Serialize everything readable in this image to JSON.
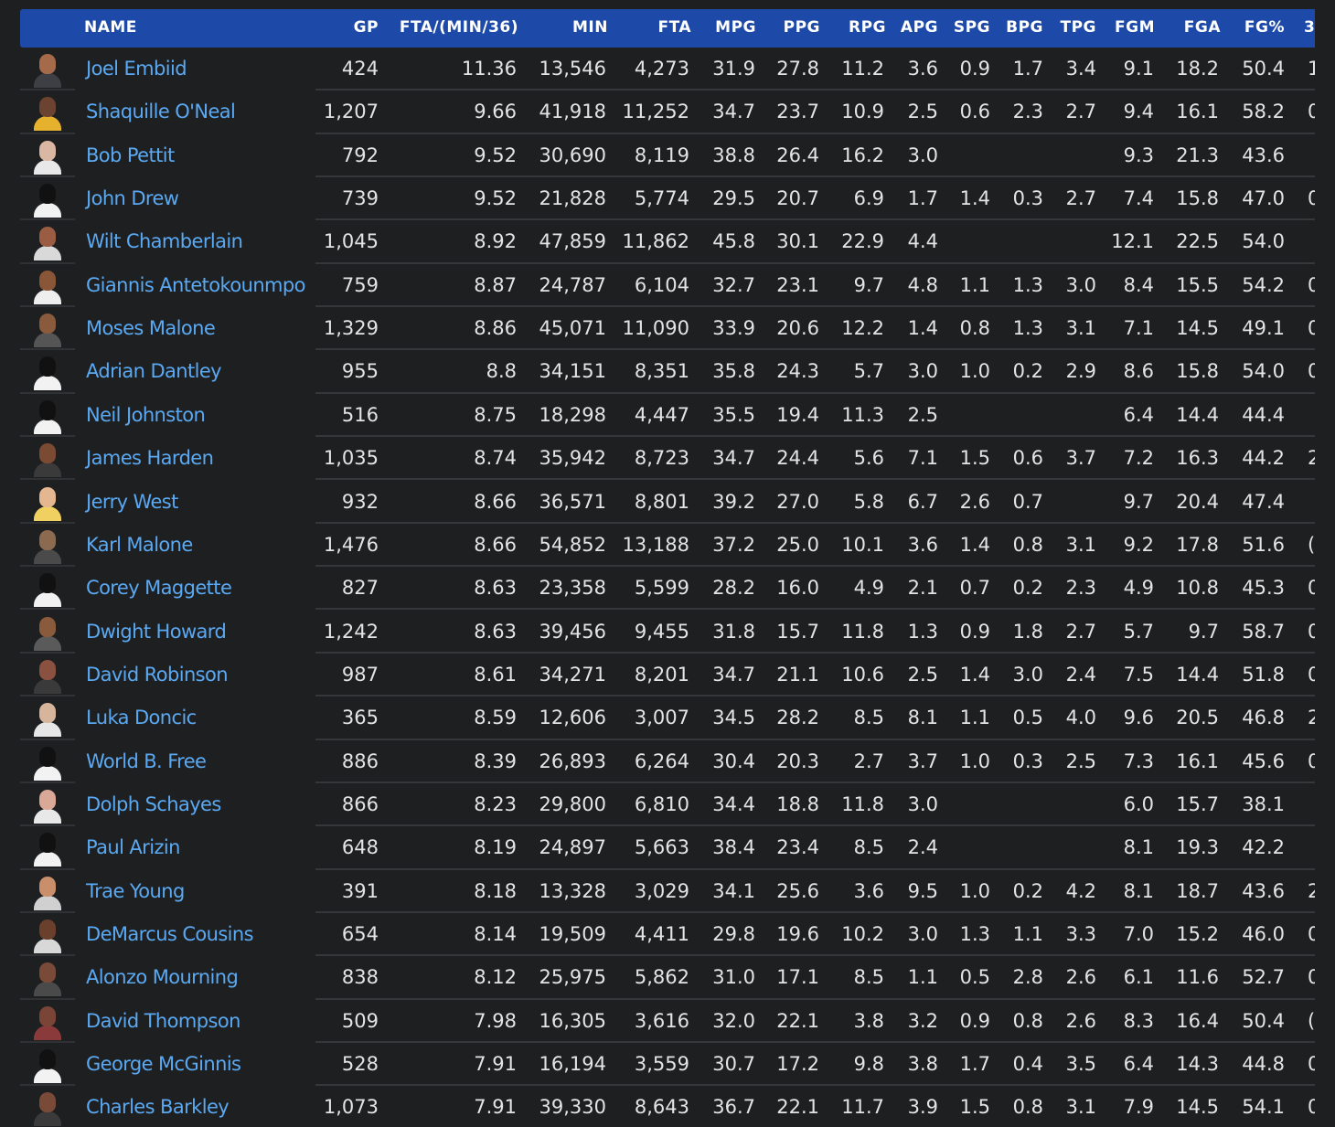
{
  "columns": [
    "NAME",
    "GP",
    "FTA/(MIN/36)",
    "MIN",
    "FTA",
    "MPG",
    "PPG",
    "RPG",
    "APG",
    "SPG",
    "BPG",
    "TPG",
    "FGM",
    "FGA",
    "FG%",
    "3"
  ],
  "colors": {
    "header_bg": "#1d4aa8",
    "name_link": "#5aa9f2",
    "page_bg": "#1e1f21"
  },
  "rows": [
    {
      "name": "Joel Embiid",
      "gp": "424",
      "fta_min36": "11.36",
      "min": "13,546",
      "fta": "4,273",
      "mpg": "31.9",
      "ppg": "27.8",
      "rpg": "11.2",
      "apg": "3.6",
      "spg": "0.9",
      "bpg": "1.7",
      "tpg": "3.4",
      "fgm": "9.1",
      "fga": "18.2",
      "fg_pct": "50.4",
      "three": "1",
      "skin": "#a46a4a",
      "jersey": "#3d3f44"
    },
    {
      "name": "Shaquille O'Neal",
      "gp": "1,207",
      "fta_min36": "9.66",
      "min": "41,918",
      "fta": "11,252",
      "mpg": "34.7",
      "ppg": "23.7",
      "rpg": "10.9",
      "apg": "2.5",
      "spg": "0.6",
      "bpg": "2.3",
      "tpg": "2.7",
      "fgm": "9.4",
      "fga": "16.1",
      "fg_pct": "58.2",
      "three": "0",
      "skin": "#6b4330",
      "jersey": "#e6b22e"
    },
    {
      "name": "Bob Pettit",
      "gp": "792",
      "fta_min36": "9.52",
      "min": "30,690",
      "fta": "8,119",
      "mpg": "38.8",
      "ppg": "26.4",
      "rpg": "16.2",
      "apg": "3.0",
      "spg": "",
      "bpg": "",
      "tpg": "",
      "fgm": "9.3",
      "fga": "21.3",
      "fg_pct": "43.6",
      "three": "",
      "skin": "#d9b7a2",
      "jersey": "#e8e8e8"
    },
    {
      "name": "John Drew",
      "gp": "739",
      "fta_min36": "9.52",
      "min": "21,828",
      "fta": "5,774",
      "mpg": "29.5",
      "ppg": "20.7",
      "rpg": "6.9",
      "apg": "1.7",
      "spg": "1.4",
      "bpg": "0.3",
      "tpg": "2.7",
      "fgm": "7.4",
      "fga": "15.8",
      "fg_pct": "47.0",
      "three": "0",
      "skin": "#111111",
      "jersey": "#f2f2f2"
    },
    {
      "name": "Wilt Chamberlain",
      "gp": "1,045",
      "fta_min36": "8.92",
      "min": "47,859",
      "fta": "11,862",
      "mpg": "45.8",
      "ppg": "30.1",
      "rpg": "22.9",
      "apg": "4.4",
      "spg": "",
      "bpg": "",
      "tpg": "",
      "fgm": "12.1",
      "fga": "22.5",
      "fg_pct": "54.0",
      "three": "",
      "skin": "#9a5d43",
      "jersey": "#d9d9d9"
    },
    {
      "name": "Giannis Antetokounmpo",
      "gp": "759",
      "fta_min36": "8.87",
      "min": "24,787",
      "fta": "6,104",
      "mpg": "32.7",
      "ppg": "23.1",
      "rpg": "9.7",
      "apg": "4.8",
      "spg": "1.1",
      "bpg": "1.3",
      "tpg": "3.0",
      "fgm": "8.4",
      "fga": "15.5",
      "fg_pct": "54.2",
      "three": "0",
      "skin": "#8a5638",
      "jersey": "#eeeeee"
    },
    {
      "name": "Moses Malone",
      "gp": "1,329",
      "fta_min36": "8.86",
      "min": "45,071",
      "fta": "11,090",
      "mpg": "33.9",
      "ppg": "20.6",
      "rpg": "12.2",
      "apg": "1.4",
      "spg": "0.8",
      "bpg": "1.3",
      "tpg": "3.1",
      "fgm": "7.1",
      "fga": "14.5",
      "fg_pct": "49.1",
      "three": "0",
      "skin": "#8a5a3c",
      "jersey": "#555555"
    },
    {
      "name": "Adrian Dantley",
      "gp": "955",
      "fta_min36": "8.8",
      "min": "34,151",
      "fta": "8,351",
      "mpg": "35.8",
      "ppg": "24.3",
      "rpg": "5.7",
      "apg": "3.0",
      "spg": "1.0",
      "bpg": "0.2",
      "tpg": "2.9",
      "fgm": "8.6",
      "fga": "15.8",
      "fg_pct": "54.0",
      "three": "0",
      "skin": "#111111",
      "jersey": "#f2f2f2"
    },
    {
      "name": "Neil Johnston",
      "gp": "516",
      "fta_min36": "8.75",
      "min": "18,298",
      "fta": "4,447",
      "mpg": "35.5",
      "ppg": "19.4",
      "rpg": "11.3",
      "apg": "2.5",
      "spg": "",
      "bpg": "",
      "tpg": "",
      "fgm": "6.4",
      "fga": "14.4",
      "fg_pct": "44.4",
      "three": "",
      "skin": "#111111",
      "jersey": "#f2f2f2"
    },
    {
      "name": "James Harden",
      "gp": "1,035",
      "fta_min36": "8.74",
      "min": "35,942",
      "fta": "8,723",
      "mpg": "34.7",
      "ppg": "24.4",
      "rpg": "5.6",
      "apg": "7.1",
      "spg": "1.5",
      "bpg": "0.6",
      "tpg": "3.7",
      "fgm": "7.2",
      "fga": "16.3",
      "fg_pct": "44.2",
      "three": "2",
      "skin": "#7a4a33",
      "jersey": "#3a3a3a"
    },
    {
      "name": "Jerry West",
      "gp": "932",
      "fta_min36": "8.66",
      "min": "36,571",
      "fta": "8,801",
      "mpg": "39.2",
      "ppg": "27.0",
      "rpg": "5.8",
      "apg": "6.7",
      "spg": "2.6",
      "bpg": "0.7",
      "tpg": "",
      "fgm": "9.7",
      "fga": "20.4",
      "fg_pct": "47.4",
      "three": "",
      "skin": "#e4b790",
      "jersey": "#f0d060"
    },
    {
      "name": "Karl Malone",
      "gp": "1,476",
      "fta_min36": "8.66",
      "min": "54,852",
      "fta": "13,188",
      "mpg": "37.2",
      "ppg": "25.0",
      "rpg": "10.1",
      "apg": "3.6",
      "spg": "1.4",
      "bpg": "0.8",
      "tpg": "3.1",
      "fgm": "9.2",
      "fga": "17.8",
      "fg_pct": "51.6",
      "three": "(",
      "skin": "#8c6a50",
      "jersey": "#4a4a4a"
    },
    {
      "name": "Corey Maggette",
      "gp": "827",
      "fta_min36": "8.63",
      "min": "23,358",
      "fta": "5,599",
      "mpg": "28.2",
      "ppg": "16.0",
      "rpg": "4.9",
      "apg": "2.1",
      "spg": "0.7",
      "bpg": "0.2",
      "tpg": "2.3",
      "fgm": "4.9",
      "fga": "10.8",
      "fg_pct": "45.3",
      "three": "0",
      "skin": "#111111",
      "jersey": "#f2f2f2"
    },
    {
      "name": "Dwight Howard",
      "gp": "1,242",
      "fta_min36": "8.63",
      "min": "39,456",
      "fta": "9,455",
      "mpg": "31.8",
      "ppg": "15.7",
      "rpg": "11.8",
      "apg": "1.3",
      "spg": "0.9",
      "bpg": "1.8",
      "tpg": "2.7",
      "fgm": "5.7",
      "fga": "9.7",
      "fg_pct": "58.7",
      "three": "0",
      "skin": "#8a5a3c",
      "jersey": "#5a5a5a"
    },
    {
      "name": "David Robinson",
      "gp": "987",
      "fta_min36": "8.61",
      "min": "34,271",
      "fta": "8,201",
      "mpg": "34.7",
      "ppg": "21.1",
      "rpg": "10.6",
      "apg": "2.5",
      "spg": "1.4",
      "bpg": "3.0",
      "tpg": "2.4",
      "fgm": "7.5",
      "fga": "14.4",
      "fg_pct": "51.8",
      "three": "0",
      "skin": "#8a5040",
      "jersey": "#3a3a3a"
    },
    {
      "name": "Luka Doncic",
      "gp": "365",
      "fta_min36": "8.59",
      "min": "12,606",
      "fta": "3,007",
      "mpg": "34.5",
      "ppg": "28.2",
      "rpg": "8.5",
      "apg": "8.1",
      "spg": "1.1",
      "bpg": "0.5",
      "tpg": "4.0",
      "fgm": "9.6",
      "fga": "20.5",
      "fg_pct": "46.8",
      "three": "2",
      "skin": "#d7b49c",
      "jersey": "#e6e6e6"
    },
    {
      "name": "World B. Free",
      "gp": "886",
      "fta_min36": "8.39",
      "min": "26,893",
      "fta": "6,264",
      "mpg": "30.4",
      "ppg": "20.3",
      "rpg": "2.7",
      "apg": "3.7",
      "spg": "1.0",
      "bpg": "0.3",
      "tpg": "2.5",
      "fgm": "7.3",
      "fga": "16.1",
      "fg_pct": "45.6",
      "three": "0",
      "skin": "#111111",
      "jersey": "#f2f2f2"
    },
    {
      "name": "Dolph Schayes",
      "gp": "866",
      "fta_min36": "8.23",
      "min": "29,800",
      "fta": "6,810",
      "mpg": "34.4",
      "ppg": "18.8",
      "rpg": "11.8",
      "apg": "3.0",
      "spg": "",
      "bpg": "",
      "tpg": "",
      "fgm": "6.0",
      "fga": "15.7",
      "fg_pct": "38.1",
      "three": "",
      "skin": "#d9a896",
      "jersey": "#e8e8e8"
    },
    {
      "name": "Paul Arizin",
      "gp": "648",
      "fta_min36": "8.19",
      "min": "24,897",
      "fta": "5,663",
      "mpg": "38.4",
      "ppg": "23.4",
      "rpg": "8.5",
      "apg": "2.4",
      "spg": "",
      "bpg": "",
      "tpg": "",
      "fgm": "8.1",
      "fga": "19.3",
      "fg_pct": "42.2",
      "three": "",
      "skin": "#111111",
      "jersey": "#f2f2f2"
    },
    {
      "name": "Trae Young",
      "gp": "391",
      "fta_min36": "8.18",
      "min": "13,328",
      "fta": "3,029",
      "mpg": "34.1",
      "ppg": "25.6",
      "rpg": "3.6",
      "apg": "9.5",
      "spg": "1.0",
      "bpg": "0.2",
      "tpg": "4.2",
      "fgm": "8.1",
      "fga": "18.7",
      "fg_pct": "43.6",
      "three": "2",
      "skin": "#c98f6a",
      "jersey": "#d0d0d0"
    },
    {
      "name": "DeMarcus Cousins",
      "gp": "654",
      "fta_min36": "8.14",
      "min": "19,509",
      "fta": "4,411",
      "mpg": "29.8",
      "ppg": "19.6",
      "rpg": "10.2",
      "apg": "3.0",
      "spg": "1.3",
      "bpg": "1.1",
      "tpg": "3.3",
      "fgm": "7.0",
      "fga": "15.2",
      "fg_pct": "46.0",
      "three": "0",
      "skin": "#6a3f2c",
      "jersey": "#d8d8d8"
    },
    {
      "name": "Alonzo Mourning",
      "gp": "838",
      "fta_min36": "8.12",
      "min": "25,975",
      "fta": "5,862",
      "mpg": "31.0",
      "ppg": "17.1",
      "rpg": "8.5",
      "apg": "1.1",
      "spg": "0.5",
      "bpg": "2.8",
      "tpg": "2.6",
      "fgm": "6.1",
      "fga": "11.6",
      "fg_pct": "52.7",
      "three": "0",
      "skin": "#7a4a38",
      "jersey": "#4a4a4a"
    },
    {
      "name": "David Thompson",
      "gp": "509",
      "fta_min36": "7.98",
      "min": "16,305",
      "fta": "3,616",
      "mpg": "32.0",
      "ppg": "22.1",
      "rpg": "3.8",
      "apg": "3.2",
      "spg": "0.9",
      "bpg": "0.8",
      "tpg": "2.6",
      "fgm": "8.3",
      "fga": "16.4",
      "fg_pct": "50.4",
      "three": "(",
      "skin": "#7a4436",
      "jersey": "#8a3a3a"
    },
    {
      "name": "George McGinnis",
      "gp": "528",
      "fta_min36": "7.91",
      "min": "16,194",
      "fta": "3,559",
      "mpg": "30.7",
      "ppg": "17.2",
      "rpg": "9.8",
      "apg": "3.8",
      "spg": "1.7",
      "bpg": "0.4",
      "tpg": "3.5",
      "fgm": "6.4",
      "fga": "14.3",
      "fg_pct": "44.8",
      "three": "0",
      "skin": "#111111",
      "jersey": "#f2f2f2"
    },
    {
      "name": "Charles Barkley",
      "gp": "1,073",
      "fta_min36": "7.91",
      "min": "39,330",
      "fta": "8,643",
      "mpg": "36.7",
      "ppg": "22.1",
      "rpg": "11.7",
      "apg": "3.9",
      "spg": "1.5",
      "bpg": "0.8",
      "tpg": "3.1",
      "fgm": "7.9",
      "fga": "14.5",
      "fg_pct": "54.1",
      "three": "0",
      "skin": "#7a4a38",
      "jersey": "#3a3a3a"
    }
  ]
}
